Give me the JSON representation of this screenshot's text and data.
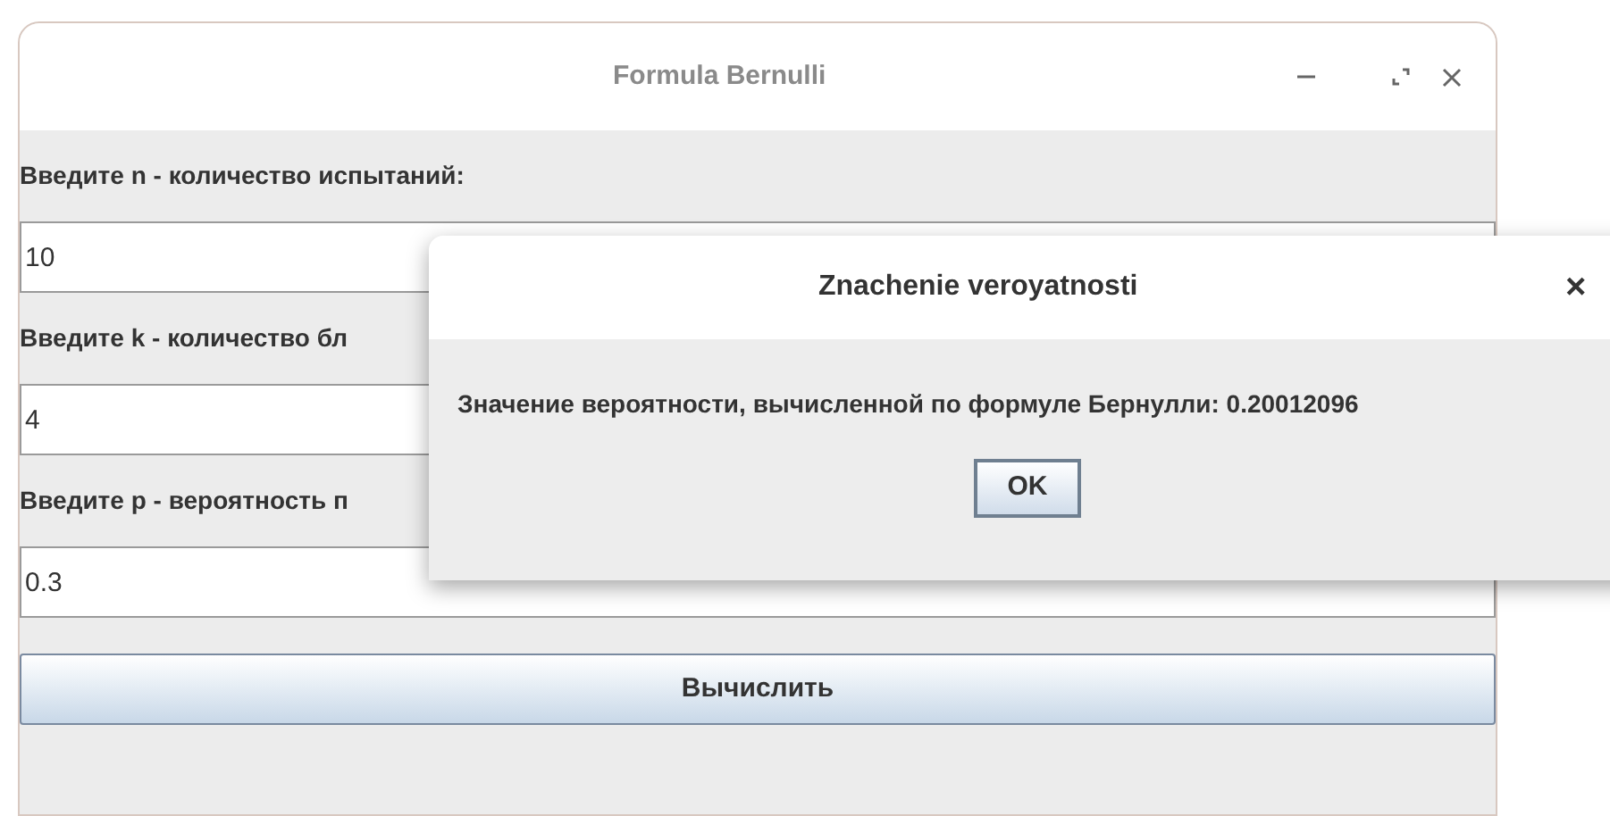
{
  "window": {
    "title": "Formula Bernulli"
  },
  "fields": [
    {
      "label": "Введите n - количество испытаний:",
      "value": "10"
    },
    {
      "label": "Введите k - количество бл",
      "value": "4"
    },
    {
      "label": "Введите p - вероятность п",
      "value": "0.3"
    }
  ],
  "calculate_button": "Вычислить",
  "dialog": {
    "title": "Znachenie veroyatnosti",
    "close": "×",
    "message": "Значение вероятности, вычисленной по формуле Бернулли: 0.20012096",
    "ok_button": "OK"
  }
}
